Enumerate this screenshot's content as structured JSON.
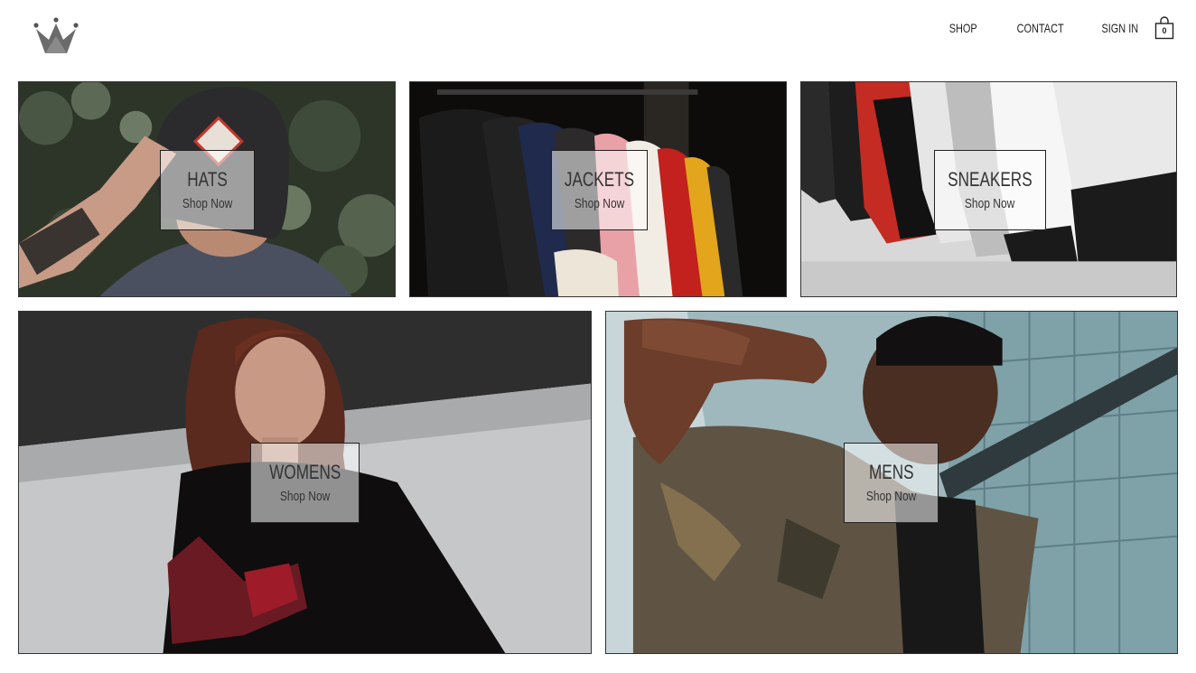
{
  "brand": {
    "logo_icon": "crown-icon"
  },
  "nav": {
    "items": [
      {
        "label": "SHOP"
      },
      {
        "label": "CONTACT"
      },
      {
        "label": "SIGN IN"
      }
    ],
    "cart": {
      "icon": "shopping-bag-icon",
      "count": "0"
    }
  },
  "categories": [
    {
      "title": "HATS",
      "cta": "Shop Now"
    },
    {
      "title": "JACKETS",
      "cta": "Shop Now"
    },
    {
      "title": "SNEAKERS",
      "cta": "Shop Now"
    },
    {
      "title": "WOMENS",
      "cta": "Shop Now"
    },
    {
      "title": "MENS",
      "cta": "Shop Now"
    }
  ],
  "colors": {
    "text": "#333333",
    "border": "#333333",
    "overlay": "rgba(255,255,255,0.55)"
  }
}
